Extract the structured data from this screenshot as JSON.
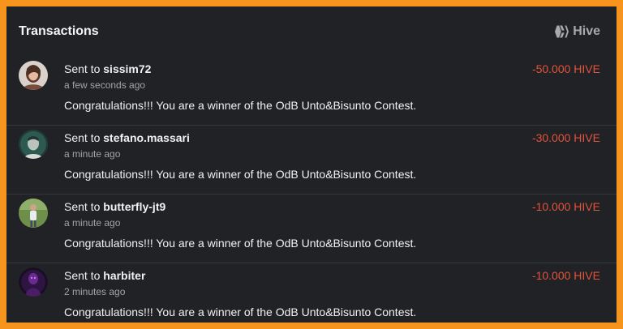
{
  "panel": {
    "title": "Transactions",
    "brand_label": "Hive",
    "brand_icon": "hive-logo-icon"
  },
  "colors": {
    "border": "#f7941d",
    "background": "#202225",
    "amount": "#e4533c",
    "muted": "#a2a4a8"
  },
  "transactions": [
    {
      "action": "Sent to ",
      "user": "sissim72",
      "time": "a few seconds ago",
      "memo": "Congratulations!!! You are a winner of the OdB Unto&Bisunto Contest.",
      "amount": "-50.000 HIVE",
      "avatar": "avatar-woman-portrait"
    },
    {
      "action": "Sent to ",
      "user": "stefano.massari",
      "time": "a minute ago",
      "memo": "Congratulations!!! You are a winner of the OdB Unto&Bisunto Contest.",
      "amount": "-30.000 HIVE",
      "avatar": "avatar-man-portrait"
    },
    {
      "action": "Sent to ",
      "user": "butterfly-jt9",
      "time": "a minute ago",
      "memo": "Congratulations!!! You are a winner of the OdB Unto&Bisunto Contest.",
      "amount": "-10.000 HIVE",
      "avatar": "avatar-person-outdoors"
    },
    {
      "action": "Sent to ",
      "user": "harbiter",
      "time": "2 minutes ago",
      "memo": "Congratulations!!! You are a winner of the OdB Unto&Bisunto Contest.",
      "amount": "-10.000 HIVE",
      "avatar": "avatar-purple-figure"
    }
  ]
}
